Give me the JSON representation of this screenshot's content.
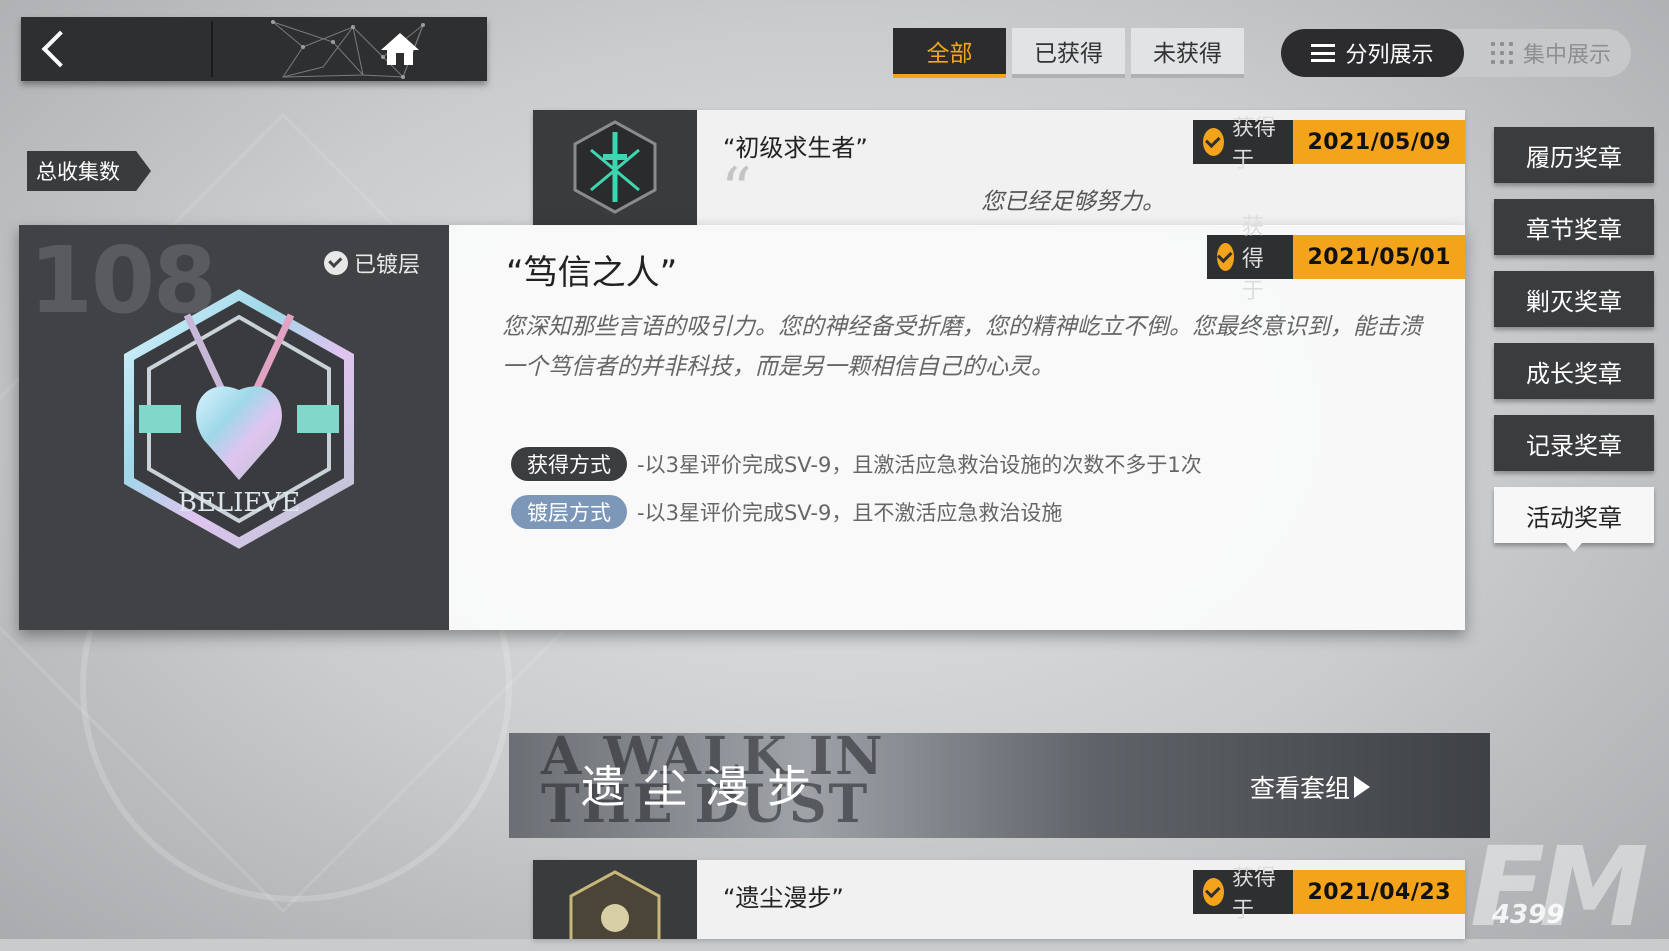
{
  "topbar": {
    "tabs": [
      {
        "label": "全部",
        "active": true
      },
      {
        "label": "已获得",
        "active": false
      },
      {
        "label": "未获得",
        "active": false
      }
    ],
    "view_modes": {
      "active_label": "分列展示",
      "inactive_label": "集中展示"
    }
  },
  "summary": {
    "total_label": "总收集数",
    "total_count": "108"
  },
  "side_nav": [
    {
      "label": "履历奖章",
      "active": false
    },
    {
      "label": "章节奖章",
      "active": false
    },
    {
      "label": "剿灭奖章",
      "active": false
    },
    {
      "label": "成长奖章",
      "active": false
    },
    {
      "label": "记录奖章",
      "active": false
    },
    {
      "label": "活动奖章",
      "active": true
    }
  ],
  "obtained_label": "获得于",
  "medal_rows": [
    {
      "title": "“初级求生者”",
      "quote": "您已经足够努力。",
      "date": "2021/05/09"
    },
    {
      "title": "“遗尘漫步”",
      "date": "2021/04/23"
    }
  ],
  "detail": {
    "plated_label": "已镀层",
    "title": "“笃信之人”",
    "date": "2021/05/01",
    "description": "您深知那些言语的吸引力。您的神经备受折磨，您的精神屹立不倒。您最终意识到，能击溃一个笃信者的并非科技，而是另一颗相信自己的心灵。",
    "medal_text": "BELIEVE",
    "obtain_method_label": "获得方式",
    "obtain_method_text": "-以3星评价完成SV-9，且激活应急救治设施的次数不多于1次",
    "plating_method_label": "镀层方式",
    "plating_method_text": "-以3星评价完成SV-9，且不激活应急救治设施"
  },
  "suite_banner": {
    "title_en": "A WALK IN THE DUST",
    "title_zh": "遗尘漫步",
    "link_label": "查看套组"
  },
  "watermark": {
    "brand": "FM",
    "number": "4399"
  },
  "colors": {
    "accent": "#f3a41a",
    "dark": "#2e2f31",
    "plating": "#7c97b8"
  }
}
